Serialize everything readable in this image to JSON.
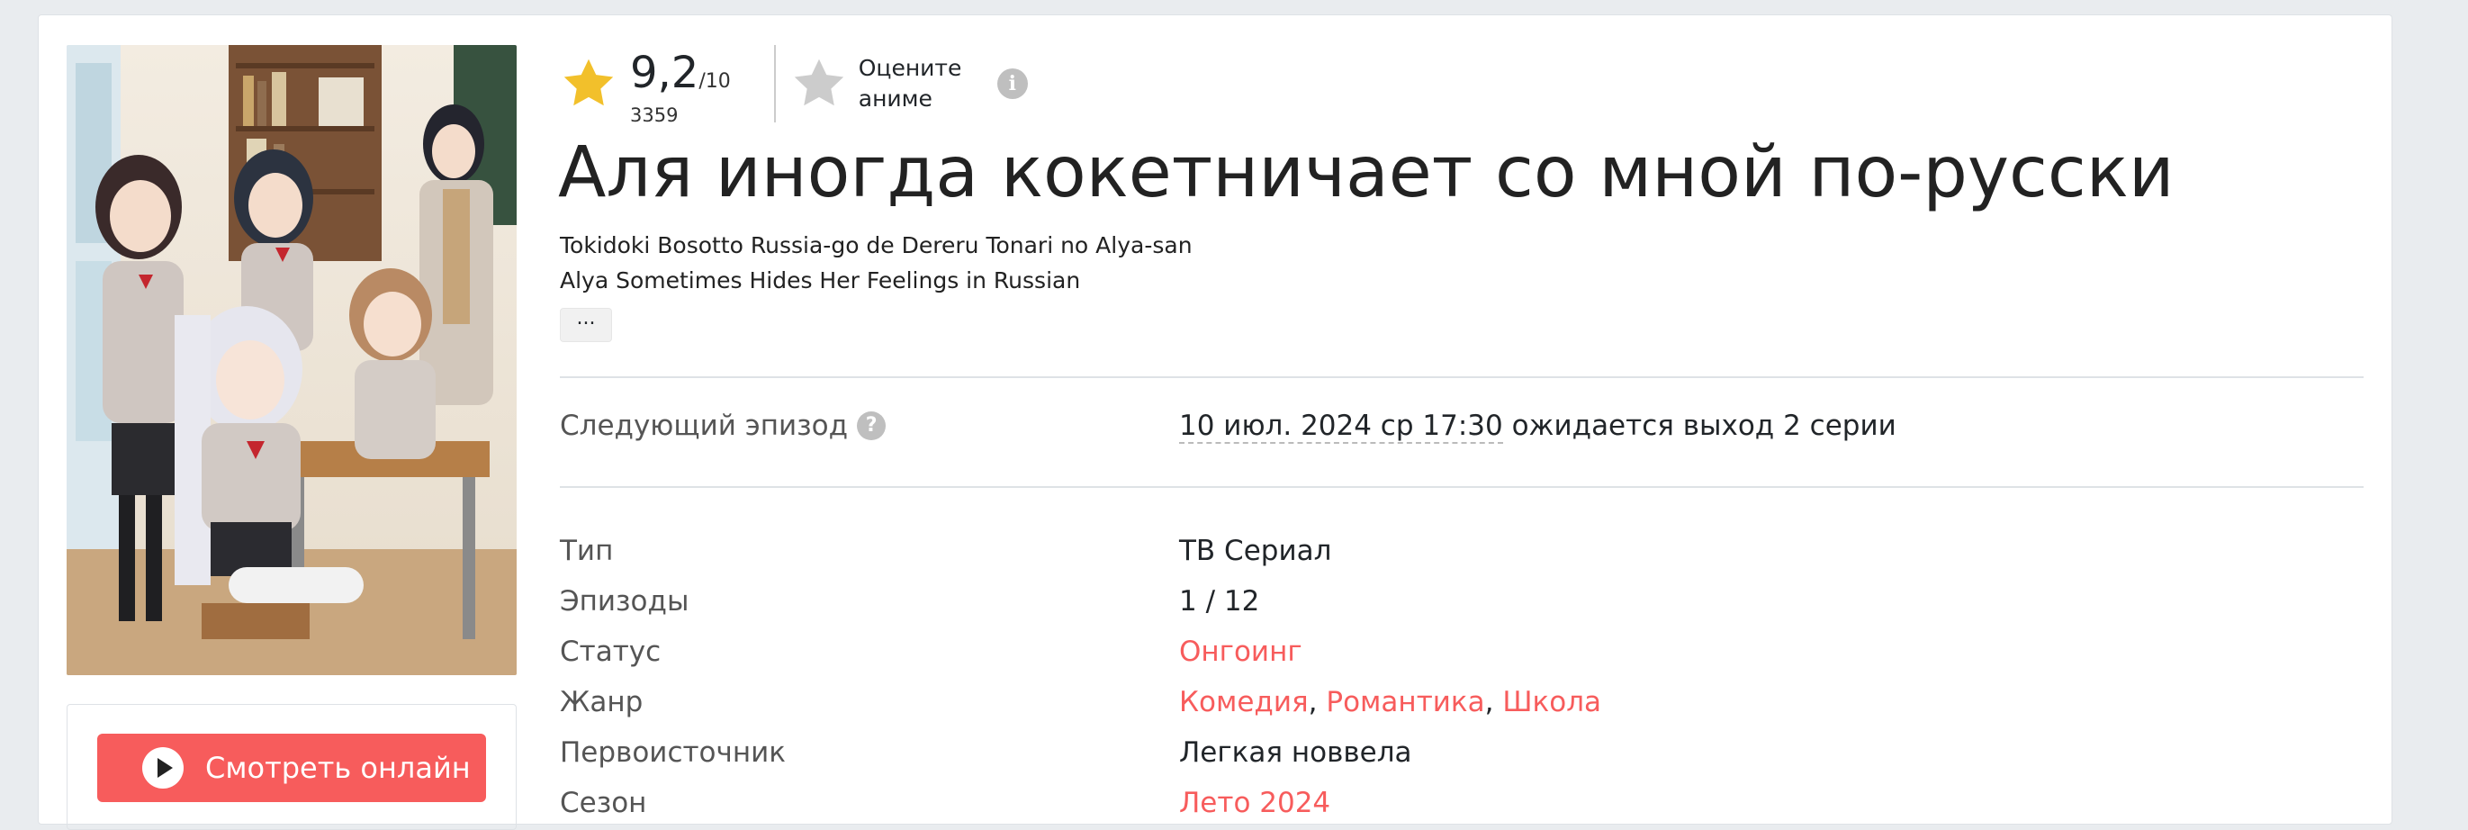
{
  "rating": {
    "score": "9,2",
    "out_of": "/10",
    "votes": "3359",
    "rate_label_line1": "Оцените",
    "rate_label_line2": "аниме",
    "star_color": "#f2c02b",
    "rate_star_color": "#cccccc"
  },
  "title": "Аля иногда кокетничает со мной по-русски",
  "alt_titles": [
    "Tokidoki Bosotto Russia-go de Dereru Tonari no Alya-san",
    "Alya Sometimes Hides Her Feelings in Russian"
  ],
  "more_label": "...",
  "next_episode": {
    "label": "Следующий эпизод",
    "help_icon": "?",
    "date": "10 июл. 2024 ср 17:30",
    "note": " ожидается выход 2 серии"
  },
  "details": {
    "type_label": "Тип",
    "type_value": "ТВ Сериал",
    "episodes_label": "Эпизоды",
    "episodes_value": "1 / 12",
    "status_label": "Статус",
    "status_value": "Онгоинг",
    "genre_label": "Жанр",
    "genres": [
      "Комедия",
      "Романтика",
      "Школа"
    ],
    "source_label": "Первоисточник",
    "source_value": "Легкая новвела",
    "season_label": "Сезон",
    "season_value": "Лето 2024"
  },
  "watch_button": "Смотреть онлайн",
  "colors": {
    "accent": "#f75c5c",
    "background": "#e9ecef"
  },
  "icons": {
    "rating": "star-icon",
    "rate": "star-outline-icon",
    "info": "info-icon",
    "help": "question-icon",
    "play": "play-icon"
  }
}
